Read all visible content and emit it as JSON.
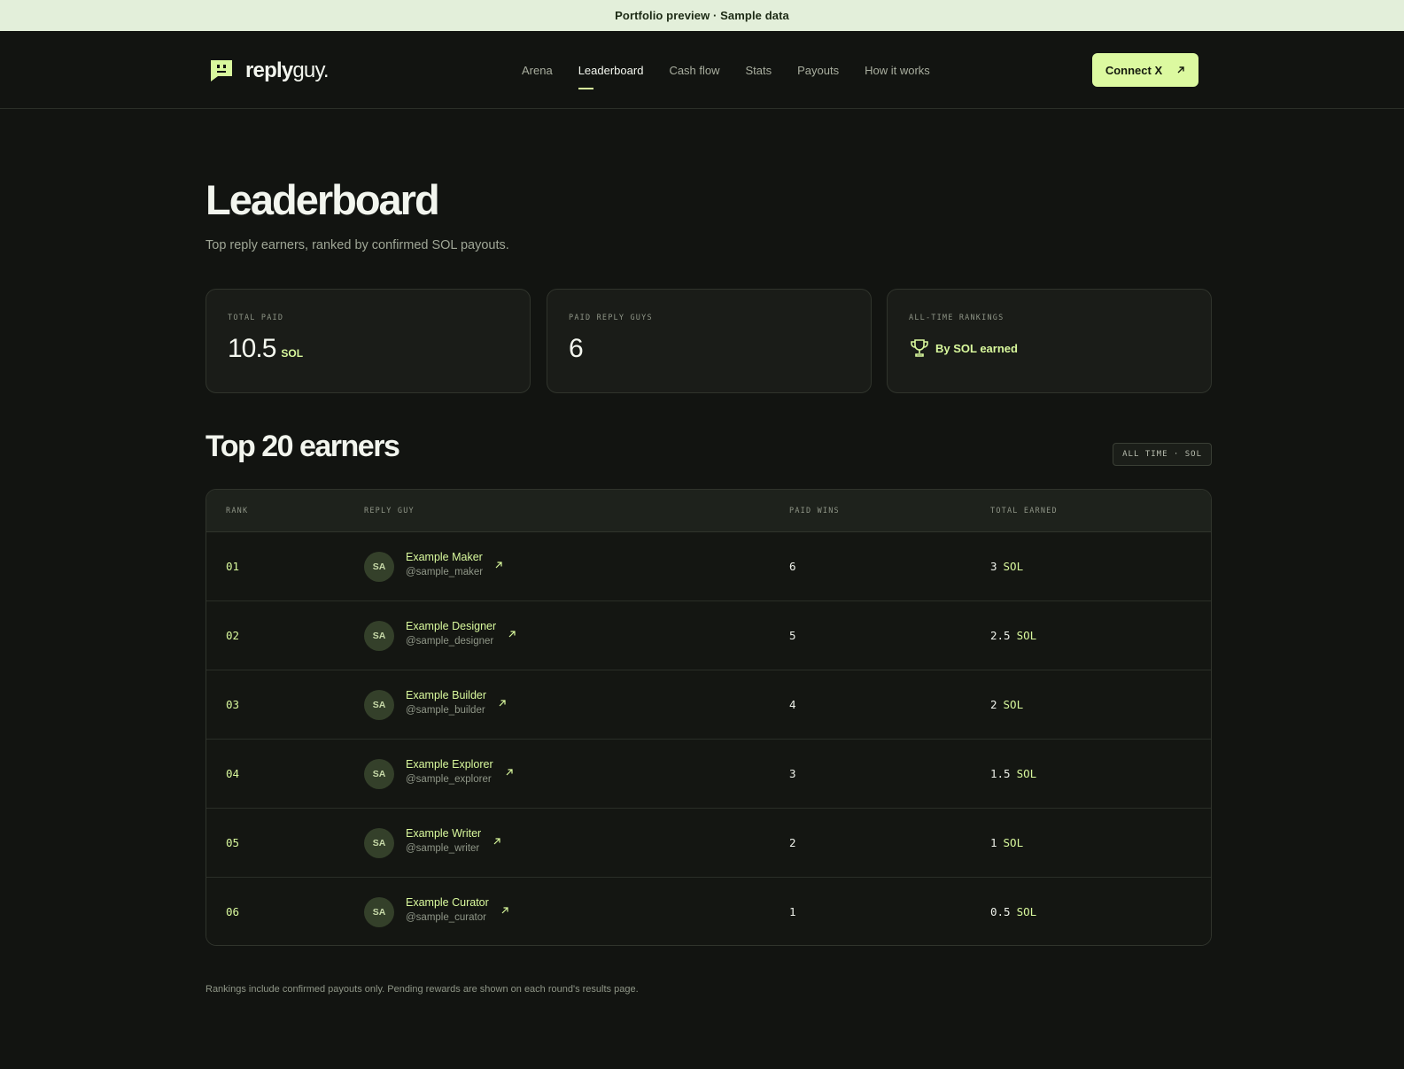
{
  "banner": {
    "text": "Portfolio preview · Sample data"
  },
  "brand": {
    "bold": "reply",
    "light": "guy."
  },
  "nav": {
    "items": [
      {
        "label": "Arena"
      },
      {
        "label": "Leaderboard"
      },
      {
        "label": "Cash flow"
      },
      {
        "label": "Stats"
      },
      {
        "label": "Payouts"
      },
      {
        "label": "How it works"
      }
    ],
    "active": "Leaderboard"
  },
  "connect": {
    "label": "Connect X",
    "icon": "arrow-up-right-icon"
  },
  "page": {
    "title": "Leaderboard",
    "subtitle": "Top reply earners, ranked by confirmed SOL payouts."
  },
  "stats": {
    "total_paid": {
      "label": "TOTAL PAID",
      "value": "10.5",
      "unit": "SOL"
    },
    "paid_guys": {
      "label": "PAID REPLY GUYS",
      "value": "6"
    },
    "rankings": {
      "label": "ALL-TIME RANKINGS",
      "value": "By SOL earned",
      "icon": "trophy-icon"
    }
  },
  "section": {
    "title": "Top 20 earners",
    "filter": "ALL TIME · SOL"
  },
  "table": {
    "headers": {
      "rank": "RANK",
      "user": "REPLY GUY",
      "wins": "PAID WINS",
      "earned": "TOTAL EARNED"
    },
    "rows": [
      {
        "rank": "01",
        "initials": "SA",
        "name": "Example Maker",
        "handle": "@sample_maker",
        "wins": "6",
        "earned": "3",
        "unit": "SOL"
      },
      {
        "rank": "02",
        "initials": "SA",
        "name": "Example Designer",
        "handle": "@sample_designer",
        "wins": "5",
        "earned": "2.5",
        "unit": "SOL"
      },
      {
        "rank": "03",
        "initials": "SA",
        "name": "Example Builder",
        "handle": "@sample_builder",
        "wins": "4",
        "earned": "2",
        "unit": "SOL"
      },
      {
        "rank": "04",
        "initials": "SA",
        "name": "Example Explorer",
        "handle": "@sample_explorer",
        "wins": "3",
        "earned": "1.5",
        "unit": "SOL"
      },
      {
        "rank": "05",
        "initials": "SA",
        "name": "Example Writer",
        "handle": "@sample_writer",
        "wins": "2",
        "earned": "1",
        "unit": "SOL"
      },
      {
        "rank": "06",
        "initials": "SA",
        "name": "Example Curator",
        "handle": "@sample_curator",
        "wins": "1",
        "earned": "0.5",
        "unit": "SOL"
      }
    ]
  },
  "footnote": "Rankings include confirmed payouts only. Pending rewards are shown on each round's results page.",
  "colors": {
    "accent": "#d9f99d",
    "background": "#121411",
    "banner": "#e3efda"
  }
}
